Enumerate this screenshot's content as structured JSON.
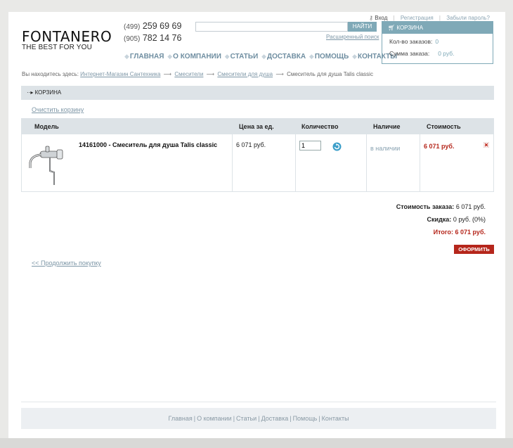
{
  "toplinks": {
    "login": "Вход",
    "register": "Регистрация",
    "forgot": "Забыли пароль?"
  },
  "logo": {
    "title": "FONTANERO",
    "subtitle": "THE BEST FOR YOU"
  },
  "phones": [
    {
      "code": "(499)",
      "number": "259 69 69"
    },
    {
      "code": "(905)",
      "number": "782 14 76"
    }
  ],
  "search": {
    "value": "",
    "placeholder": "",
    "button_label": "НАЙТИ",
    "advanced_link": "Расширенный поиск"
  },
  "nav": {
    "items": [
      "ГЛАВНАЯ",
      "О КОМПАНИИ",
      "СТАТЬИ",
      "ДОСТАВКА",
      "ПОМОЩЬ",
      "КОНТАКТЫ"
    ]
  },
  "cart_box": {
    "title": "КОРЗИНА",
    "orders_label": "Кол-во заказов:",
    "orders_value": "0",
    "sum_label": "Сумма заказа:",
    "sum_value": "0 руб."
  },
  "breadcrumb": {
    "prefix": "Вы находитесь здесь:",
    "items": [
      "Интернет-Магазин Сантехника",
      "Смесители",
      "Смесители для душа"
    ],
    "current": "Смеситель для душа Talis classic"
  },
  "section": {
    "title": "КОРЗИНА",
    "clear_cart": "Очистить корзину"
  },
  "table": {
    "headers": {
      "model": "Модель",
      "price": "Цена за ед.",
      "quantity": "Количество",
      "availability": "Наличие",
      "cost": "Стоимость"
    },
    "rows": [
      {
        "name": "14161000 - Смеситель для душа Talis classic",
        "price": "6 071 руб.",
        "quantity": "1",
        "availability": "в наличии",
        "cost": "6 071 руб."
      }
    ]
  },
  "totals": {
    "order_cost_label": "Стоимость заказа:",
    "order_cost_value": "6 071 руб.",
    "discount_label": "Скидка:",
    "discount_value": "0 руб. (0%)",
    "total_label": "Итого:",
    "total_value": "6 071 руб."
  },
  "checkout_label": "ОФОРМИТЬ",
  "continue_label": "<< Продолжить покупку",
  "footer": {
    "links": [
      "Главная",
      "О компании",
      "Статьи",
      "Доставка",
      "Помощь",
      "Контакты"
    ]
  },
  "colors": {
    "accent": "#7fa9b7",
    "price_red": "#b5261b",
    "header_gray": "#dde3e7"
  }
}
